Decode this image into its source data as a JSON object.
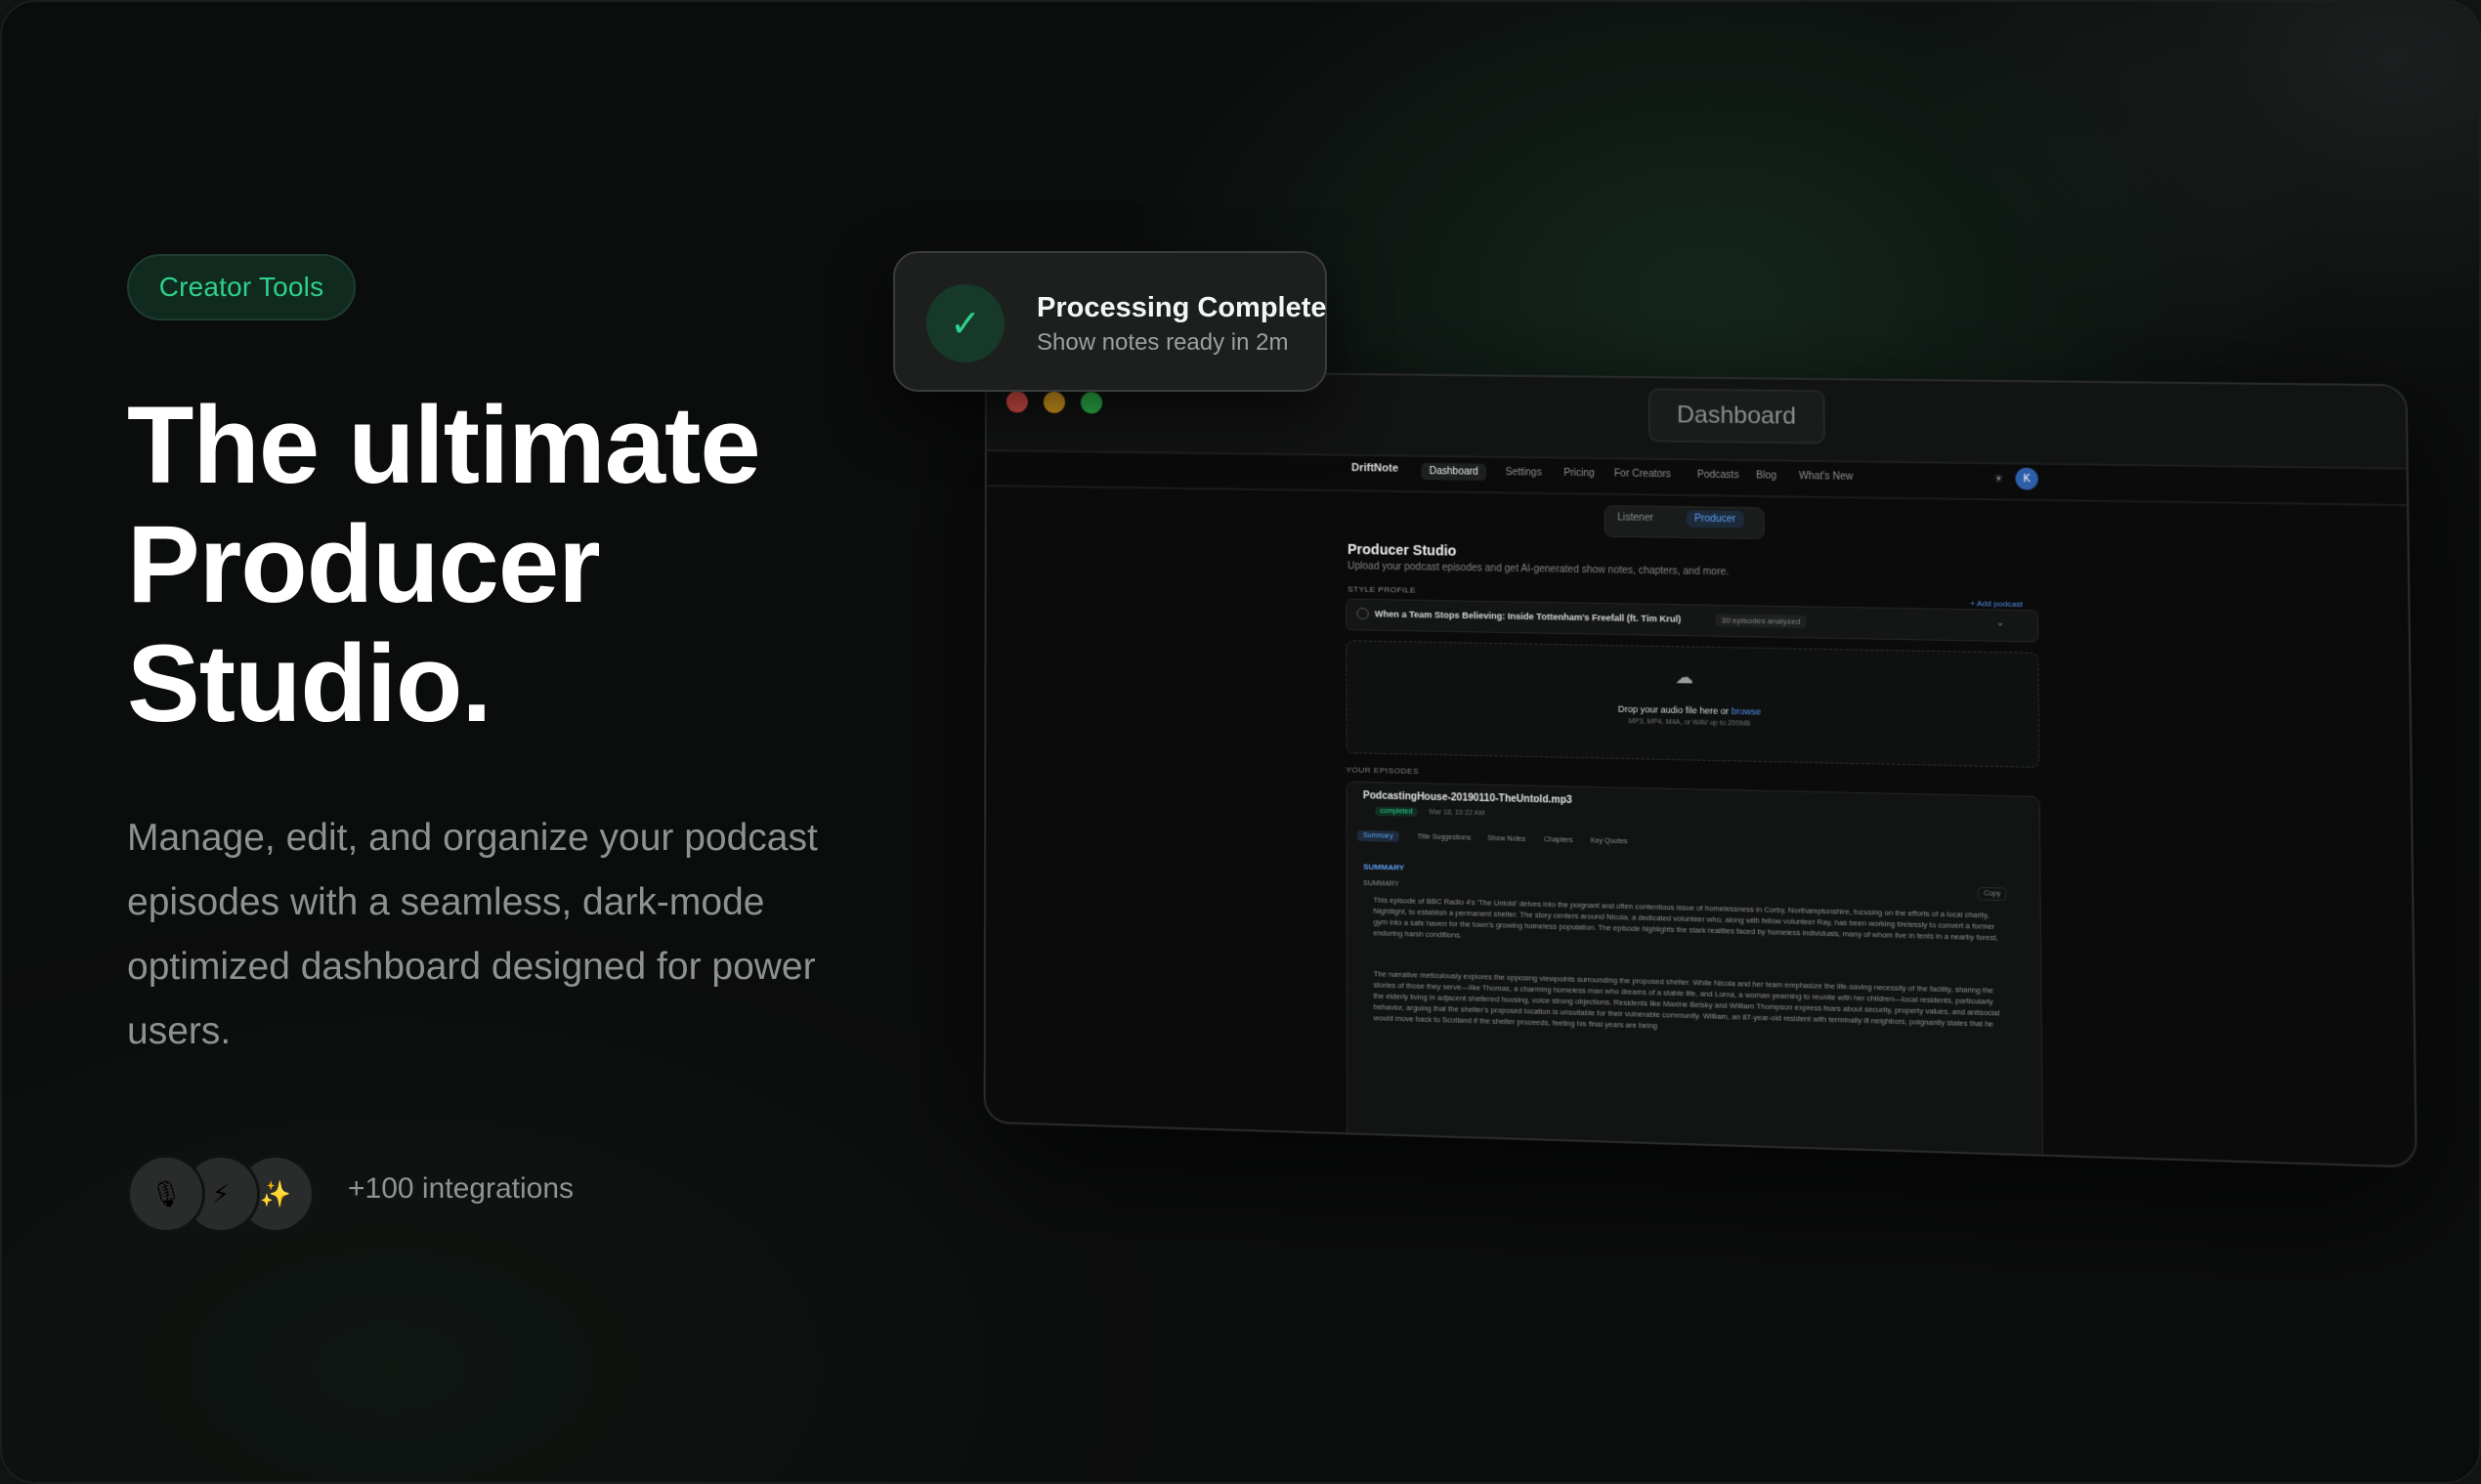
{
  "badge": "Creator Tools",
  "headline": [
    "The ultimate",
    "Producer",
    "Studio."
  ],
  "description": "Manage, edit, and organize your podcast episodes with a seamless, dark-mode optimized dashboard designed for power users.",
  "integrations": {
    "icons": [
      "microphone-icon",
      "lightning-icon",
      "sparkles-icon"
    ],
    "glyphs": [
      "🎙",
      "⚡",
      "✨"
    ],
    "label": "+100 integrations"
  },
  "toast": {
    "title": "Processing Complete",
    "subtitle": "Show notes ready in 2m",
    "check": "✓"
  },
  "app": {
    "window_title": "Dashboard",
    "brand": "DriftNote",
    "nav": [
      "Dashboard",
      "Settings",
      "Pricing",
      "For Creators",
      "Podcasts",
      "Blog",
      "What's New"
    ],
    "avatar_initial": "K",
    "mode_toggle": [
      "Listener",
      "Producer"
    ],
    "page_title": "Producer Studio",
    "page_subtitle": "Upload your podcast episodes and get AI-generated show notes, chapters, and more.",
    "style_profile_label": "STYLE PROFILE",
    "add_podcast": "+ Add podcast",
    "profile_title": "When a Team Stops Believing: Inside Tottenham's Freefall (ft. Tim Krul)",
    "profile_badge": "30 episodes analyzed",
    "drop_text": "Drop your audio file here or",
    "drop_link": "browse",
    "drop_formats": "MP3, MP4, M4A, or WAV up to 200MB",
    "episodes_label": "YOUR EPISODES",
    "episode": {
      "file": "PodcastingHouse-20190110-TheUntold.mp3",
      "status": "completed",
      "date": "Mar 18, 10:22 AM",
      "tabs": [
        "Summary",
        "Title Suggestions",
        "Show Notes",
        "Chapters",
        "Key Quotes"
      ],
      "section": "SUMMARY",
      "subsection": "SUMMARY",
      "copy": "Copy",
      "para1": "This episode of BBC Radio 4's 'The Untold' delves into the poignant and often contentious issue of homelessness in Corby, Northamptonshire, focusing on the efforts of a local charity, Nightlight, to establish a permanent shelter. The story centers around Nicola, a dedicated volunteer who, along with fellow volunteer Ray, has been working tirelessly to convert a former gym into a safe haven for the town's growing homeless population. The episode highlights the stark realities faced by homeless individuals, many of whom live in tents in a nearby forest, enduring harsh conditions.",
      "para2": "The narrative meticulously explores the opposing viewpoints surrounding the proposed shelter. While Nicola and her team emphasize the life-saving necessity of the facility, sharing the stories of those they serve—like Thomas, a charming homeless man who dreams of a stable life, and Lorna, a woman yearning to reunite with her children—local residents, particularly the elderly living in adjacent sheltered housing, voice strong objections. Residents like Maxine Belsky and William Thompson express fears about security, property values, and antisocial behavior, arguing that the shelter's proposed location is unsuitable for their vulnerable community. William, an 87-year-old resident with terminally ill neighbors, poignantly states that he would move back to Scotland if the shelter proceeds, feeling his final years are being"
    }
  },
  "colors": {
    "accent": "#2ed08a",
    "link_blue": "#4e8fe8",
    "traffic_red": "#e5534b",
    "traffic_yellow": "#e3a51f",
    "traffic_green": "#2fbf4f"
  }
}
